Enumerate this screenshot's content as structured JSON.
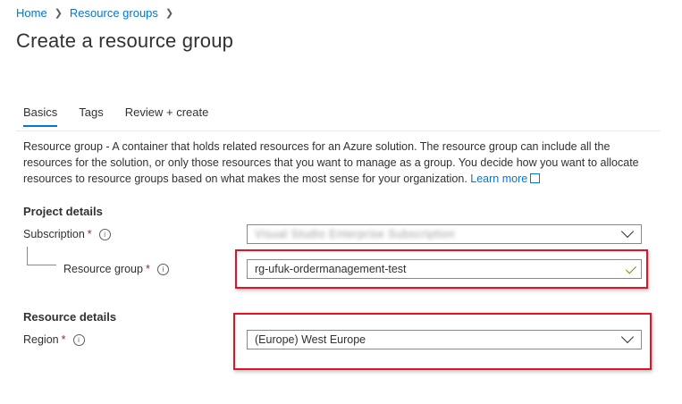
{
  "breadcrumb": {
    "items": [
      "Home",
      "Resource groups"
    ]
  },
  "page": {
    "title": "Create a resource group"
  },
  "tabs": [
    {
      "label": "Basics",
      "active": true
    },
    {
      "label": "Tags",
      "active": false
    },
    {
      "label": "Review + create",
      "active": false
    }
  ],
  "description": {
    "term": "Resource group",
    "text": " - A container that holds related resources for an Azure solution. The resource group can include all the resources for the solution, or only those resources that you want to manage as a group. You decide how you want to allocate resources to resource groups based on what makes the most sense for your organization. ",
    "learn_more": "Learn more"
  },
  "project_details": {
    "heading": "Project details",
    "subscription": {
      "label": "Subscription",
      "required": "*",
      "value": "Visual Studio Enterprise Subscription"
    },
    "resource_group": {
      "label": "Resource group",
      "required": "*",
      "value": "rg-ufuk-ordermanagement-test"
    }
  },
  "resource_details": {
    "heading": "Resource details",
    "region": {
      "label": "Region",
      "required": "*",
      "value": "(Europe) West Europe"
    }
  },
  "icons": {
    "info": "info-icon",
    "chevron": "chevron-down-icon",
    "valid": "checkmark-icon",
    "external": "external-link-icon"
  },
  "colors": {
    "accent": "#0078d4",
    "required": "#a4262c",
    "highlight": "#e81123",
    "valid": "#57a300"
  }
}
